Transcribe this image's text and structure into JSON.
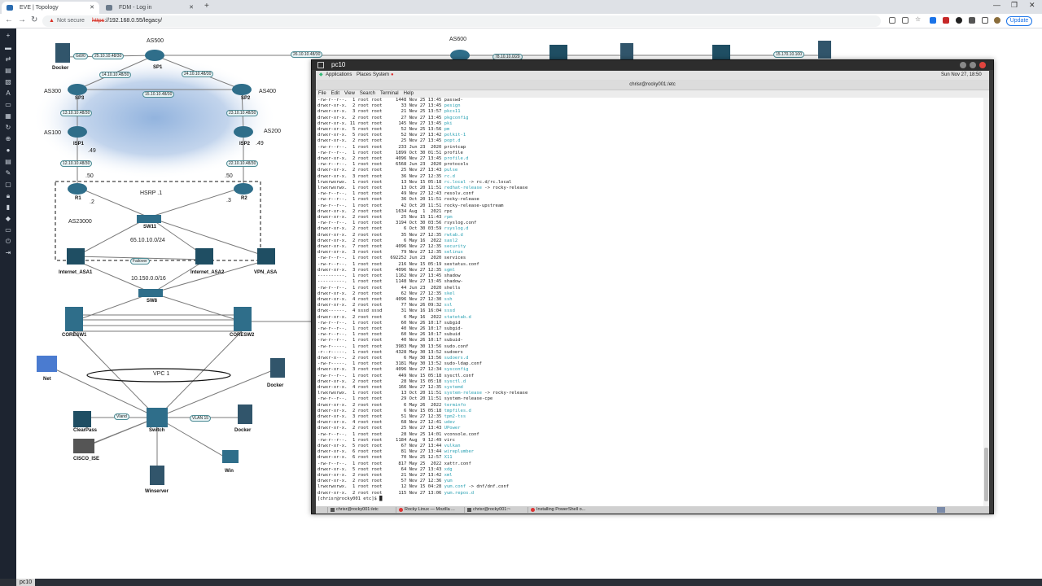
{
  "browser": {
    "tabs": [
      {
        "label": "EVE | Topology",
        "active": true
      },
      {
        "label": "FDM - Log in",
        "active": false
      }
    ],
    "security_text": "Not secure",
    "url_scheme": "https",
    "url_rest": "://192.168.0.55/legacy/",
    "update_label": "Update"
  },
  "eve": {
    "bottom_tab": "pc10",
    "as_labels": [
      "AS500",
      "AS600",
      "AS300",
      "AS400",
      "AS100",
      "AS200",
      "HSRP .1",
      "AS23000",
      "65.10.10.0/24",
      "10.150.0.0/16",
      "VPC 1"
    ],
    "nodes": [
      "Docker",
      "SP1",
      "SP2",
      "SP3",
      "ISP1",
      "ISP2",
      "R1",
      "R2",
      "SW11",
      "Internet_ASA1",
      "Internet_ASA2",
      "VPN_ASA",
      "SW8",
      "CORESW1",
      "CORESW2",
      "Net",
      "Docker",
      "ClearPass",
      "Switch",
      "Docker",
      "CISCO_ISE",
      "Winserver",
      "Win"
    ],
    "links": [
      "Gi0/0",
      "25.10.10.48/30",
      "26.10.10.48/30",
      "78.10.10.0/29",
      "15.170.10.100",
      "14.10.10.48/30",
      "15.10.10.48/30",
      "24.10.10.48/30",
      "13.10.10.48/30",
      "23.10.10.48/30",
      "12.10.10.48/30",
      "22.10.10.48/30",
      "Failover",
      "Vland",
      "VLAN 15",
      ".49",
      ".50",
      ".2",
      ".3"
    ]
  },
  "terminal": {
    "window_title": "pc10",
    "gnome_menus": [
      "Applications",
      "Places",
      "System"
    ],
    "clock": "Sun Nov 27, 18:50",
    "title": "chrisr@rocky001:/etc",
    "menu": [
      "File",
      "Edit",
      "View",
      "Search",
      "Terminal",
      "Help"
    ],
    "lines": [
      [
        "-rw-r--r--.  1 root root     1448 Nov 25 13:45 ",
        "passwd-",
        ""
      ],
      [
        "drwxr-xr-x.  2 root root       33 Nov 27 13:45 ",
        "pesign",
        "c"
      ],
      [
        "drwxr-xr-x.  3 root root       21 Nov 25 13:57 ",
        "pkcs11",
        "c"
      ],
      [
        "drwxr-xr-x.  2 root root       27 Nov 27 13:45 ",
        "pkgconfig",
        "c"
      ],
      [
        "drwxr-xr-x. 11 root root      145 Nov 27 13:45 ",
        "pki",
        "c"
      ],
      [
        "drwxr-xr-x.  5 root root       52 Nov 25 13:56 ",
        "pm",
        "c"
      ],
      [
        "drwxr-xr-x.  5 root root       52 Nov 27 13:42 ",
        "polkit-1",
        "c"
      ],
      [
        "drwxr-xr-x.  2 root root       25 Nov 27 13:45 ",
        "popt.d",
        "c"
      ],
      [
        "-rw-r--r--.  1 root root      233 Jun 23  2020 ",
        "printcap",
        ""
      ],
      [
        "-rw-r--r--.  1 root root     1899 Oct 30 01:51 ",
        "profile",
        ""
      ],
      [
        "drwxr-xr-x.  2 root root     4096 Nov 27 13:45 ",
        "profile.d",
        "c"
      ],
      [
        "-rw-r--r--.  1 root root     6568 Jun 23  2020 ",
        "protocols",
        ""
      ],
      [
        "drwxr-xr-x.  2 root root       25 Nov 27 13:43 ",
        "pulse",
        "c"
      ],
      [
        "drwxr-xr-x.  3 root root       36 Nov 27 12:35 ",
        "rc.d",
        "c"
      ],
      [
        "lrwxrwxrwx.  1 root root       13 Nov 15 05:18 ",
        "rc.local",
        "c",
        "-> rc.d/rc.local"
      ],
      [
        "lrwxrwxrwx.  1 root root       13 Oct 20 11:51 ",
        "redhat-release",
        "c",
        "-> rocky-release"
      ],
      [
        "-rw-r--r--.  1 root root       49 Nov 27 12:43 ",
        "resolv.conf",
        ""
      ],
      [
        "-rw-r--r--.  1 root root       36 Oct 20 11:51 ",
        "rocky-release",
        ""
      ],
      [
        "-rw-r--r--.  1 root root       42 Oct 20 11:51 ",
        "rocky-release-upstream",
        ""
      ],
      [
        "drwxr-xr-x.  2 root root     1634 Aug  1  2021 ",
        "rpc",
        ""
      ],
      [
        "drwxr-xr-x.  2 root root       25 Nov 15 11:43 ",
        "rpm",
        "c"
      ],
      [
        "-rw-r--r--.  1 root root     3194 Oct 30 03:56 ",
        "rsyslog.conf",
        ""
      ],
      [
        "drwxr-xr-x.  2 root root        6 Oct 30 03:59 ",
        "rsyslog.d",
        "c"
      ],
      [
        "drwxr-xr-x.  2 root root       35 Nov 27 12:35 ",
        "rwtab.d",
        "c"
      ],
      [
        "drwxr-xr-x.  2 root root        6 May 16  2022 ",
        "sasl2",
        "c"
      ],
      [
        "drwxr-xr-x.  7 root root     4096 Nov 27 12:35 ",
        "security",
        "c"
      ],
      [
        "drwxr-xr-x.  3 root root       79 Nov 27 12:35 ",
        "selinux",
        "c"
      ],
      [
        "-rw-r--r--.  1 root root   692252 Jun 23  2020 ",
        "services",
        ""
      ],
      [
        "-rw-r--r--.  1 root root      216 Nov 15 05:19 ",
        "sestatus.conf",
        ""
      ],
      [
        "drwxr-xr-x.  3 root root     4096 Nov 27 12:35 ",
        "sgml",
        "c"
      ],
      [
        "----------.  1 root root     1162 Nov 27 13:45 ",
        "shadow",
        ""
      ],
      [
        "----------.  1 root root     1148 Nov 27 13:45 ",
        "shadow-",
        ""
      ],
      [
        "-rw-r--r--.  1 root root       44 Jun 23  2020 ",
        "shells",
        ""
      ],
      [
        "drwxr-xr-x.  2 root root       62 Nov 27 12:35 ",
        "skel",
        "c"
      ],
      [
        "drwxr-xr-x.  4 root root     4096 Nov 27 12:30 ",
        "ssh",
        "c"
      ],
      [
        "drwxr-xr-x.  2 root root       77 Nov 26 09:32 ",
        "ssl",
        "c"
      ],
      [
        "drwx------.  4 sssd sssd       31 Nov 16 16:04 ",
        "sssd",
        "c"
      ],
      [
        "drwxr-xr-x.  2 root root        6 May 16  2022 ",
        "statetab.d",
        "c"
      ],
      [
        "-rw-r--r--.  1 root root       60 Nov 26 10:17 ",
        "subgid",
        ""
      ],
      [
        "-rw-r--r--.  1 root root       40 Nov 26 10:17 ",
        "subgid-",
        ""
      ],
      [
        "-rw-r--r--.  1 root root       60 Nov 26 10:17 ",
        "subuid",
        ""
      ],
      [
        "-rw-r--r--.  1 root root       40 Nov 26 10:17 ",
        "subuid-",
        ""
      ],
      [
        "-rw-r-----.  1 root root     3983 May 30 13:56 ",
        "sudo.conf",
        ""
      ],
      [
        "-r--r-----.  1 root root     4328 May 30 13:52 ",
        "sudoers",
        ""
      ],
      [
        "drwxr-x---.  2 root root        6 May 30 13:56 ",
        "sudoers.d",
        "c"
      ],
      [
        "-rw-r-----.  1 root root     3181 May 30 13:52 ",
        "sudo-ldap.conf",
        ""
      ],
      [
        "drwxr-xr-x.  3 root root     4096 Nov 27 12:34 ",
        "sysconfig",
        "c"
      ],
      [
        "-rw-r--r--.  1 root root      449 Nov 15 05:18 ",
        "sysctl.conf",
        ""
      ],
      [
        "drwxr-xr-x.  2 root root       28 Nov 15 05:18 ",
        "sysctl.d",
        "c"
      ],
      [
        "drwxr-xr-x.  4 root root      166 Nov 27 12:35 ",
        "systemd",
        "c"
      ],
      [
        "lrwxrwxrwx.  1 root root       13 Oct 20 11:51 ",
        "system-release",
        "c",
        "-> rocky-release"
      ],
      [
        "-rw-r--r--.  1 root root       29 Oct 20 11:51 ",
        "system-release-cpe",
        ""
      ],
      [
        "drwxr-xr-x.  2 root root        6 May 26  2022 ",
        "terminfo",
        "c"
      ],
      [
        "drwxr-xr-x.  2 root root        6 Nov 15 05:18 ",
        "tmpfiles.d",
        "c"
      ],
      [
        "drwxr-xr-x.  3 root root       51 Nov 27 12:35 ",
        "tpm2-tss",
        "c"
      ],
      [
        "drwxr-xr-x.  4 root root       68 Nov 27 12:41 ",
        "udev",
        "c"
      ],
      [
        "drwxr-xr-x.  2 root root       25 Nov 27 13:43 ",
        "UPower",
        "c"
      ],
      [
        "-rw-r--r--.  1 root root       28 Nov 25 14:01 ",
        "vconsole.conf",
        ""
      ],
      [
        "-rw-r--r--.  1 root root     1184 Aug  9 12:49 ",
        "virc",
        ""
      ],
      [
        "drwxr-xr-x.  5 root root       67 Nov 27 13:44 ",
        "vulkan",
        "c"
      ],
      [
        "drwxr-xr-x.  6 root root       81 Nov 27 13:44 ",
        "wireplumber",
        "c"
      ],
      [
        "drwxr-xr-x.  6 root root       70 Nov 25 12:57 ",
        "X11",
        "c"
      ],
      [
        "-rw-r--r--.  1 root root      817 May 25  2022 ",
        "xattr.conf",
        ""
      ],
      [
        "drwxr-xr-x.  5 root root       64 Nov 27 13:43 ",
        "xdg",
        "c"
      ],
      [
        "drwxr-xr-x.  2 root root       21 Nov 27 13:42 ",
        "xml",
        "c"
      ],
      [
        "drwxr-xr-x.  2 root root       57 Nov 27 12:36 ",
        "yum",
        "c"
      ],
      [
        "lrwxrwxrwx.  1 root root       12 Nov 15 04:28 ",
        "yum.conf",
        "c",
        "-> dnf/dnf.conf"
      ],
      [
        "drwxr-xr-x.  2 root root      115 Nov 27 13:06 ",
        "yum.repos.d",
        "c"
      ]
    ],
    "prompt": "[chrisr@rocky001 etc]$ ",
    "taskbar": [
      "chrisr@rocky001:/etc",
      "Rocky Linux — Mozilla ...",
      "chrisr@rocky001:~",
      "Installing PowerShell o..."
    ]
  },
  "colors": {
    "eve_toolbar": "#1d2430",
    "link_border": "#4d8c95",
    "dir_color": "#2aa1b3",
    "accent": "#1a73e8"
  }
}
